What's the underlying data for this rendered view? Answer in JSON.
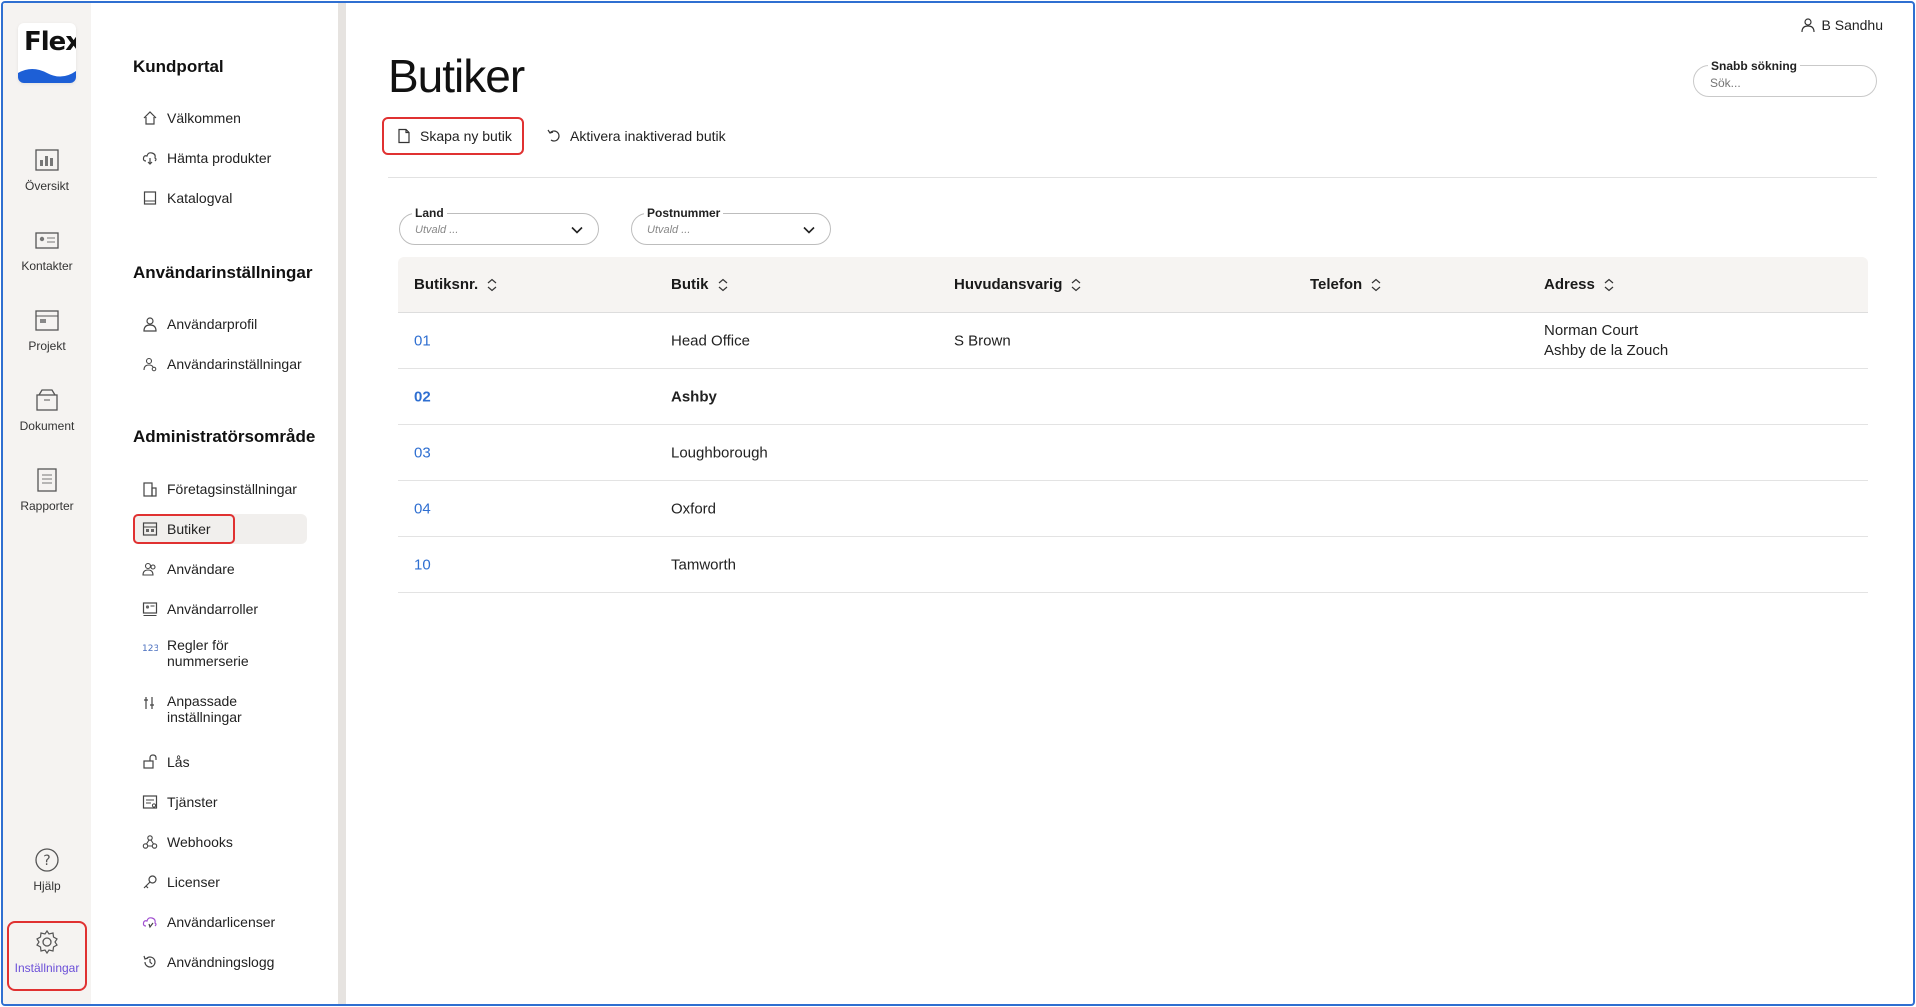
{
  "user": {
    "name": "B Sandhu"
  },
  "rail": {
    "logo": "Flex",
    "items": [
      {
        "label": "Översikt",
        "icon": "chart-icon"
      },
      {
        "label": "Kontakter",
        "icon": "contact-card-icon"
      },
      {
        "label": "Projekt",
        "icon": "project-icon"
      },
      {
        "label": "Dokument",
        "icon": "document-box-icon"
      },
      {
        "label": "Rapporter",
        "icon": "report-icon"
      }
    ],
    "help": "Hjälp",
    "settings": "Inställningar"
  },
  "subnav": {
    "sections": [
      {
        "title": "Kundportal",
        "items": [
          "Välkommen",
          "Hämta produkter",
          "Katalogval"
        ]
      },
      {
        "title": "Användarinställningar",
        "items": [
          "Användarprofil",
          "Användarinställningar"
        ]
      },
      {
        "title": "Administratörsområde",
        "items": [
          "Företagsinställningar",
          "Butiker",
          "Användare",
          "Användarroller",
          "Regler för nummerserie",
          "Anpassade inställningar",
          "Lås",
          "Tjänster",
          "Webhooks",
          "Licenser",
          "Användarlicenser",
          "Användningslogg"
        ]
      }
    ]
  },
  "page": {
    "title": "Butiker",
    "quick_search_label": "Snabb sökning",
    "quick_search_placeholder": "Sök...",
    "create_btn": "Skapa ny butik",
    "activate_btn": "Aktivera inaktiverad butik",
    "filters": [
      {
        "label": "Land",
        "value": "Utvald ..."
      },
      {
        "label": "Postnummer",
        "value": "Utvald ..."
      }
    ]
  },
  "table": {
    "columns": [
      "Butiksnr.",
      "Butik",
      "Huvudansvarig",
      "Telefon",
      "Adress"
    ],
    "rows": [
      {
        "num": "01",
        "name": "Head Office",
        "manager": "S Brown",
        "phone": "",
        "addr1": "Norman Court",
        "addr2": "Ashby de la Zouch"
      },
      {
        "num": "02",
        "name": "Ashby",
        "manager": "",
        "phone": "",
        "addr1": "",
        "addr2": ""
      },
      {
        "num": "03",
        "name": "Loughborough",
        "manager": "",
        "phone": "",
        "addr1": "",
        "addr2": ""
      },
      {
        "num": "04",
        "name": "Oxford",
        "manager": "",
        "phone": "",
        "addr1": "",
        "addr2": ""
      },
      {
        "num": "10",
        "name": "Tamworth",
        "manager": "",
        "phone": "",
        "addr1": "",
        "addr2": ""
      }
    ]
  },
  "colors": {
    "accent": "#2f6fd1",
    "highlight": "#e03131",
    "active_settings": "#6b4fd8"
  }
}
